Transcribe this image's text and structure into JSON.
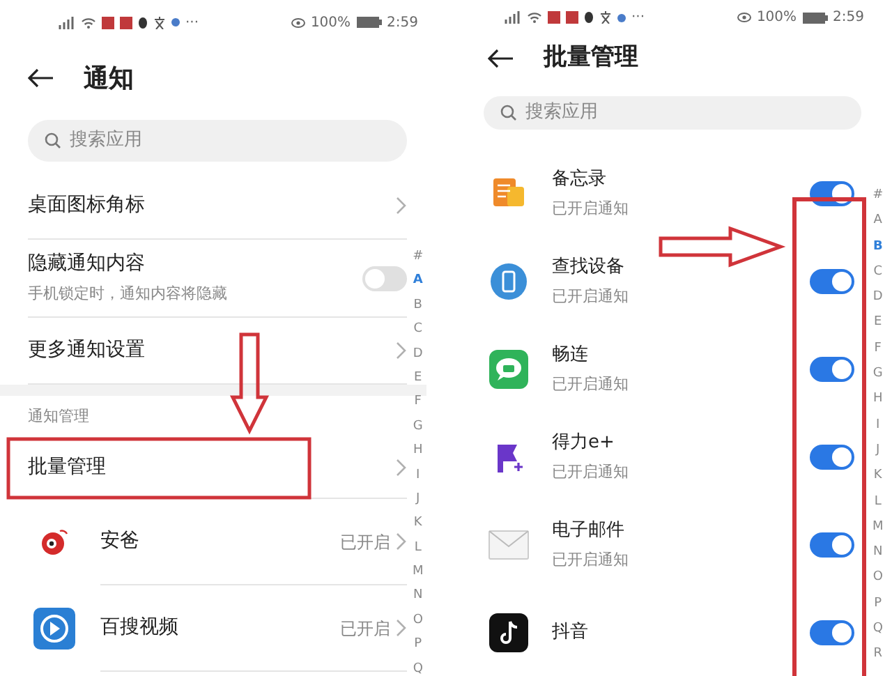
{
  "left_screen": {
    "status_bar": {
      "more": "···",
      "battery": "100%",
      "time": "2:59"
    },
    "title": "通知",
    "search": {
      "placeholder": "搜索应用"
    },
    "settings": [
      {
        "kind": "link",
        "label": "桌面图标角标"
      },
      {
        "kind": "switch",
        "label": "隐藏通知内容",
        "description": "手机锁定时，通知内容将隐藏",
        "on": false
      },
      {
        "kind": "link",
        "label": "更多通知设置"
      }
    ],
    "section_header": "通知管理",
    "batch_item": {
      "label": "批量管理"
    },
    "apps": [
      {
        "name": "安爸",
        "status": "已开启"
      },
      {
        "name": "百搜视频",
        "status": "已开启"
      }
    ],
    "index": [
      {
        "letter": "#",
        "selected": false
      },
      {
        "letter": "A",
        "selected": true
      },
      {
        "letter": "B",
        "selected": false
      },
      {
        "letter": "C",
        "selected": false
      },
      {
        "letter": "D",
        "selected": false
      },
      {
        "letter": "E",
        "selected": false
      },
      {
        "letter": "F",
        "selected": false
      },
      {
        "letter": "G",
        "selected": false
      },
      {
        "letter": "H",
        "selected": false
      },
      {
        "letter": "I",
        "selected": false
      },
      {
        "letter": "J",
        "selected": false
      },
      {
        "letter": "K",
        "selected": false
      },
      {
        "letter": "L",
        "selected": false
      },
      {
        "letter": "M",
        "selected": false
      },
      {
        "letter": "N",
        "selected": false
      },
      {
        "letter": "O",
        "selected": false
      },
      {
        "letter": "P",
        "selected": false
      },
      {
        "letter": "Q",
        "selected": false
      }
    ]
  },
  "right_screen": {
    "status_bar": {
      "more": "···",
      "battery": "100%",
      "time": "2:59"
    },
    "title": "批量管理",
    "search": {
      "placeholder": "搜索应用"
    },
    "apps": [
      {
        "name": "备忘录",
        "status": "已开启通知",
        "on": true
      },
      {
        "name": "查找设备",
        "status": "已开启通知",
        "on": true
      },
      {
        "name": "畅连",
        "status": "已开启通知",
        "on": true
      },
      {
        "name": "得力e+",
        "status": "已开启通知",
        "on": true
      },
      {
        "name": "电子邮件",
        "status": "已开启通知",
        "on": true
      },
      {
        "name": "抖音",
        "on": true
      }
    ],
    "index": [
      {
        "letter": "#",
        "selected": false
      },
      {
        "letter": "A",
        "selected": false
      },
      {
        "letter": "B",
        "selected": true
      },
      {
        "letter": "C",
        "selected": false
      },
      {
        "letter": "D",
        "selected": false
      },
      {
        "letter": "E",
        "selected": false
      },
      {
        "letter": "F",
        "selected": false
      },
      {
        "letter": "G",
        "selected": false
      },
      {
        "letter": "H",
        "selected": false
      },
      {
        "letter": "I",
        "selected": false
      },
      {
        "letter": "J",
        "selected": false
      },
      {
        "letter": "K",
        "selected": false
      },
      {
        "letter": "L",
        "selected": false
      },
      {
        "letter": "M",
        "selected": false
      },
      {
        "letter": "N",
        "selected": false
      },
      {
        "letter": "O",
        "selected": false
      },
      {
        "letter": "P",
        "selected": false
      },
      {
        "letter": "Q",
        "selected": false
      },
      {
        "letter": "R",
        "selected": false
      }
    ]
  }
}
